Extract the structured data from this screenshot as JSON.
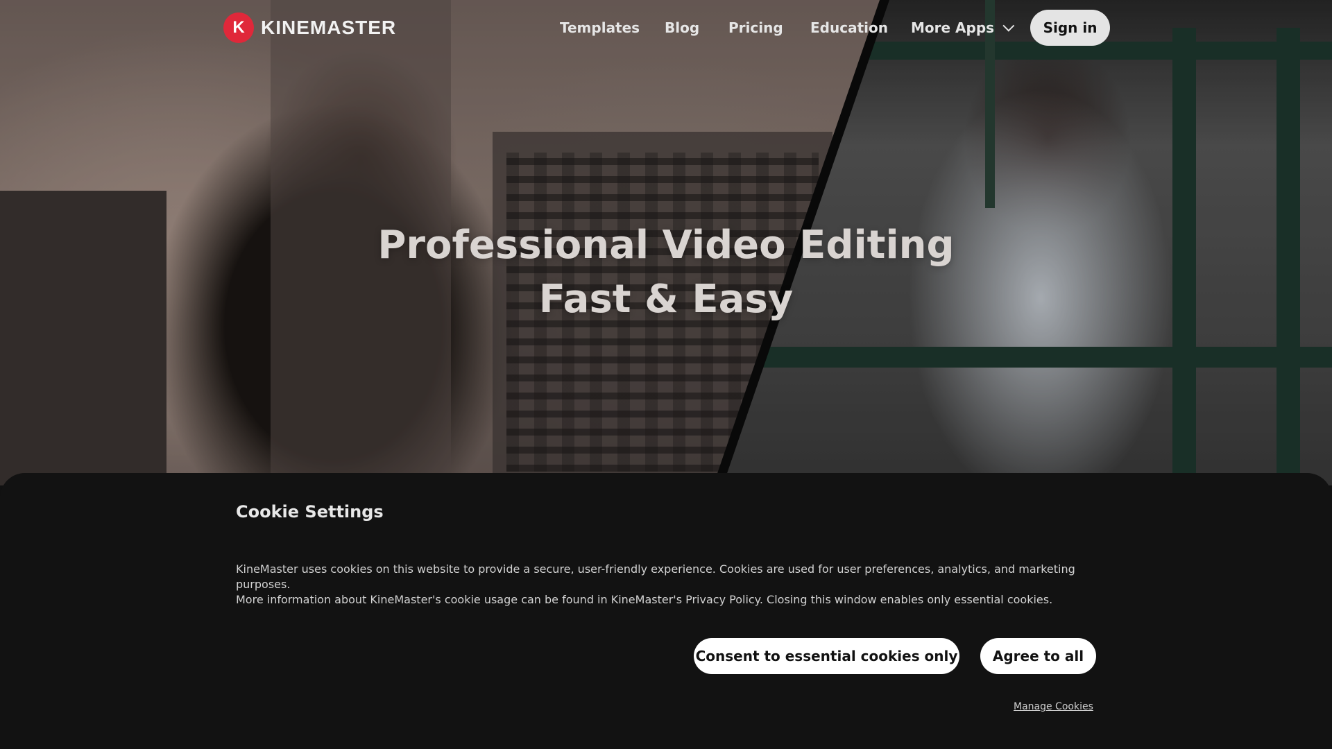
{
  "brand": {
    "logo_letter": "K",
    "name": "KINEMASTER",
    "accent_color": "#e0283a"
  },
  "nav": {
    "links": [
      {
        "label": "Templates"
      },
      {
        "label": "Blog"
      },
      {
        "label": "Pricing"
      },
      {
        "label": "Education"
      },
      {
        "label": "More Apps",
        "icon": "chevron-down-icon"
      }
    ],
    "sign_in_label": "Sign in"
  },
  "hero": {
    "title_line1": "Professional Video Editing",
    "title_line2": "Fast & Easy"
  },
  "cookie_banner": {
    "title": "Cookie Settings",
    "text_line1": "KineMaster uses cookies on this website to provide a secure, user-friendly experience. Cookies are used for user preferences, analytics, and marketing purposes.",
    "text_line2": "More information about KineMaster's cookie usage can be found in KineMaster's Privacy Policy. Closing this window enables only essential cookies.",
    "essential_button_label": "Consent to essential cookies only",
    "agree_button_label": "Agree to all",
    "manage_link_label": "Manage Cookies"
  }
}
